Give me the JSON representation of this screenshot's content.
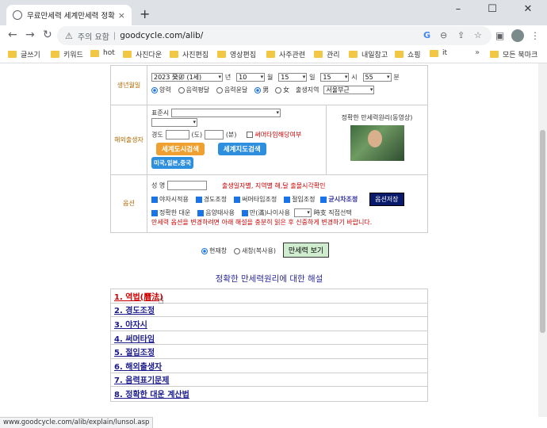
{
  "browser": {
    "tab_title": "무료만세력 세계만세력 정확한",
    "tab_close": "×",
    "new_tab": "+",
    "win_min": "–",
    "win_max": "☐",
    "win_close": "✕",
    "back": "←",
    "forward": "→",
    "reload": "↻",
    "security_label": "주의 요함",
    "url": "goodcycle.com/alib/",
    "icons": [
      "google-icon",
      "zoom-icon",
      "share-icon",
      "star-icon",
      "sidebar-icon",
      "profile-avatar",
      "menu-icon"
    ]
  },
  "bookmarks": [
    {
      "label": "글쓰기"
    },
    {
      "label": "키워드"
    },
    {
      "label": "hot"
    },
    {
      "label": "사진다운"
    },
    {
      "label": "사진편집"
    },
    {
      "label": "영상편집"
    },
    {
      "label": "사주관련"
    },
    {
      "label": "관리"
    },
    {
      "label": "내일참고"
    },
    {
      "label": "쇼핑"
    },
    {
      "label": "it"
    }
  ],
  "bookmarks_more": "»",
  "bookmarks_all": "모든 북마크",
  "birth": {
    "label": "생년월일",
    "year": "2023 癸卯 (1세)",
    "year_unit": "년",
    "month": "10",
    "month_unit": "월",
    "day": "15",
    "day_unit": "일",
    "hour": "15",
    "hour_unit": "시",
    "minute": "55",
    "minute_unit": "분",
    "cal_solar": "양력",
    "cal_lunar_normal": "음력평달",
    "cal_lunar_leap": "음력윤달",
    "sex_male": "男",
    "sex_female": "女",
    "region_label": "출생지역",
    "region_value": "서울부근"
  },
  "overseas": {
    "label": "해외출생자",
    "std_time_label": "표준시",
    "longitude_label": "경도",
    "deg_unit": "(도)",
    "min_unit": "(분)",
    "summer_time": "써머타임해당여부",
    "world_city_btn": "세계도시검색",
    "world_map_btn": "세계지도검색",
    "us_jp_cn_btn": "미국,일본,중국",
    "side_title": "정확한 만세력원리(동영상)"
  },
  "options": {
    "label": "옵션",
    "name_label": "성 명",
    "name_hint": "출생일자별, 지역별 해,달 출몰시각확인",
    "opt_night": "야자시적용",
    "opt_longitude": "경도조정",
    "opt_summer": "써머타임조정",
    "opt_jeolip": "절입조정",
    "opt_solar_time": "균시차조정",
    "save_btn": "옵션저장",
    "opt_exact": "정확한 대운",
    "opt_yinyang": "음양태사용",
    "opt_age": "만(滿)나이사용",
    "hour_direct": "時支 직접선택",
    "notice": "만세력 옵션을 변경하려면 아래 해설을 충분히 읽은 후 신중하게 변경하기 바랍니다."
  },
  "display": {
    "current_window": "현재창",
    "new_window": "새창(복사용)",
    "view_btn": "만세력 보기"
  },
  "explain": {
    "heading": "정확한 만세력원리에 대한 해설",
    "items": [
      "1. 역법(曆法)",
      "2. 경도조정",
      "3. 야자시",
      "4. 써머타임",
      "5. 절입조정",
      "6. 해외출생자",
      "7. 음력표기문제",
      "8. 정확한 대운 계산법"
    ]
  },
  "status_url": "www.goodcycle.com/alib/explain/lunsol.asp"
}
